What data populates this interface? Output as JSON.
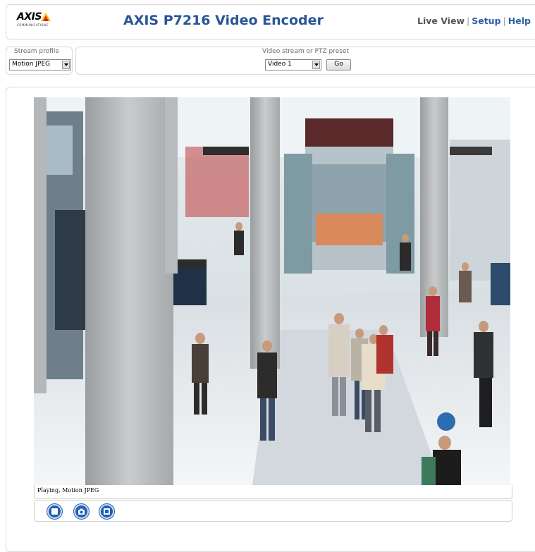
{
  "header": {
    "logo_text": "AXIS",
    "logo_subtext": "COMMUNICATIONS",
    "title": "AXIS P7216 Video Encoder",
    "nav": {
      "live_view": "Live View",
      "setup": "Setup",
      "help": "Help",
      "separator": "|"
    }
  },
  "stream_profile": {
    "label": "Stream profile",
    "value": "Motion JPEG"
  },
  "video_source": {
    "label": "Video stream or PTZ preset",
    "value": "Video 1",
    "go_label": "Go"
  },
  "player": {
    "status": "Playing, Motion JPEG",
    "controls": [
      "stop-icon",
      "snapshot-icon",
      "view-full-screen-icon"
    ]
  },
  "colors": {
    "title_blue": "#2a5595",
    "link_blue": "#2a5fa5",
    "control_blue": "#1f5fb5",
    "logo_yellow": "#f4c400"
  }
}
